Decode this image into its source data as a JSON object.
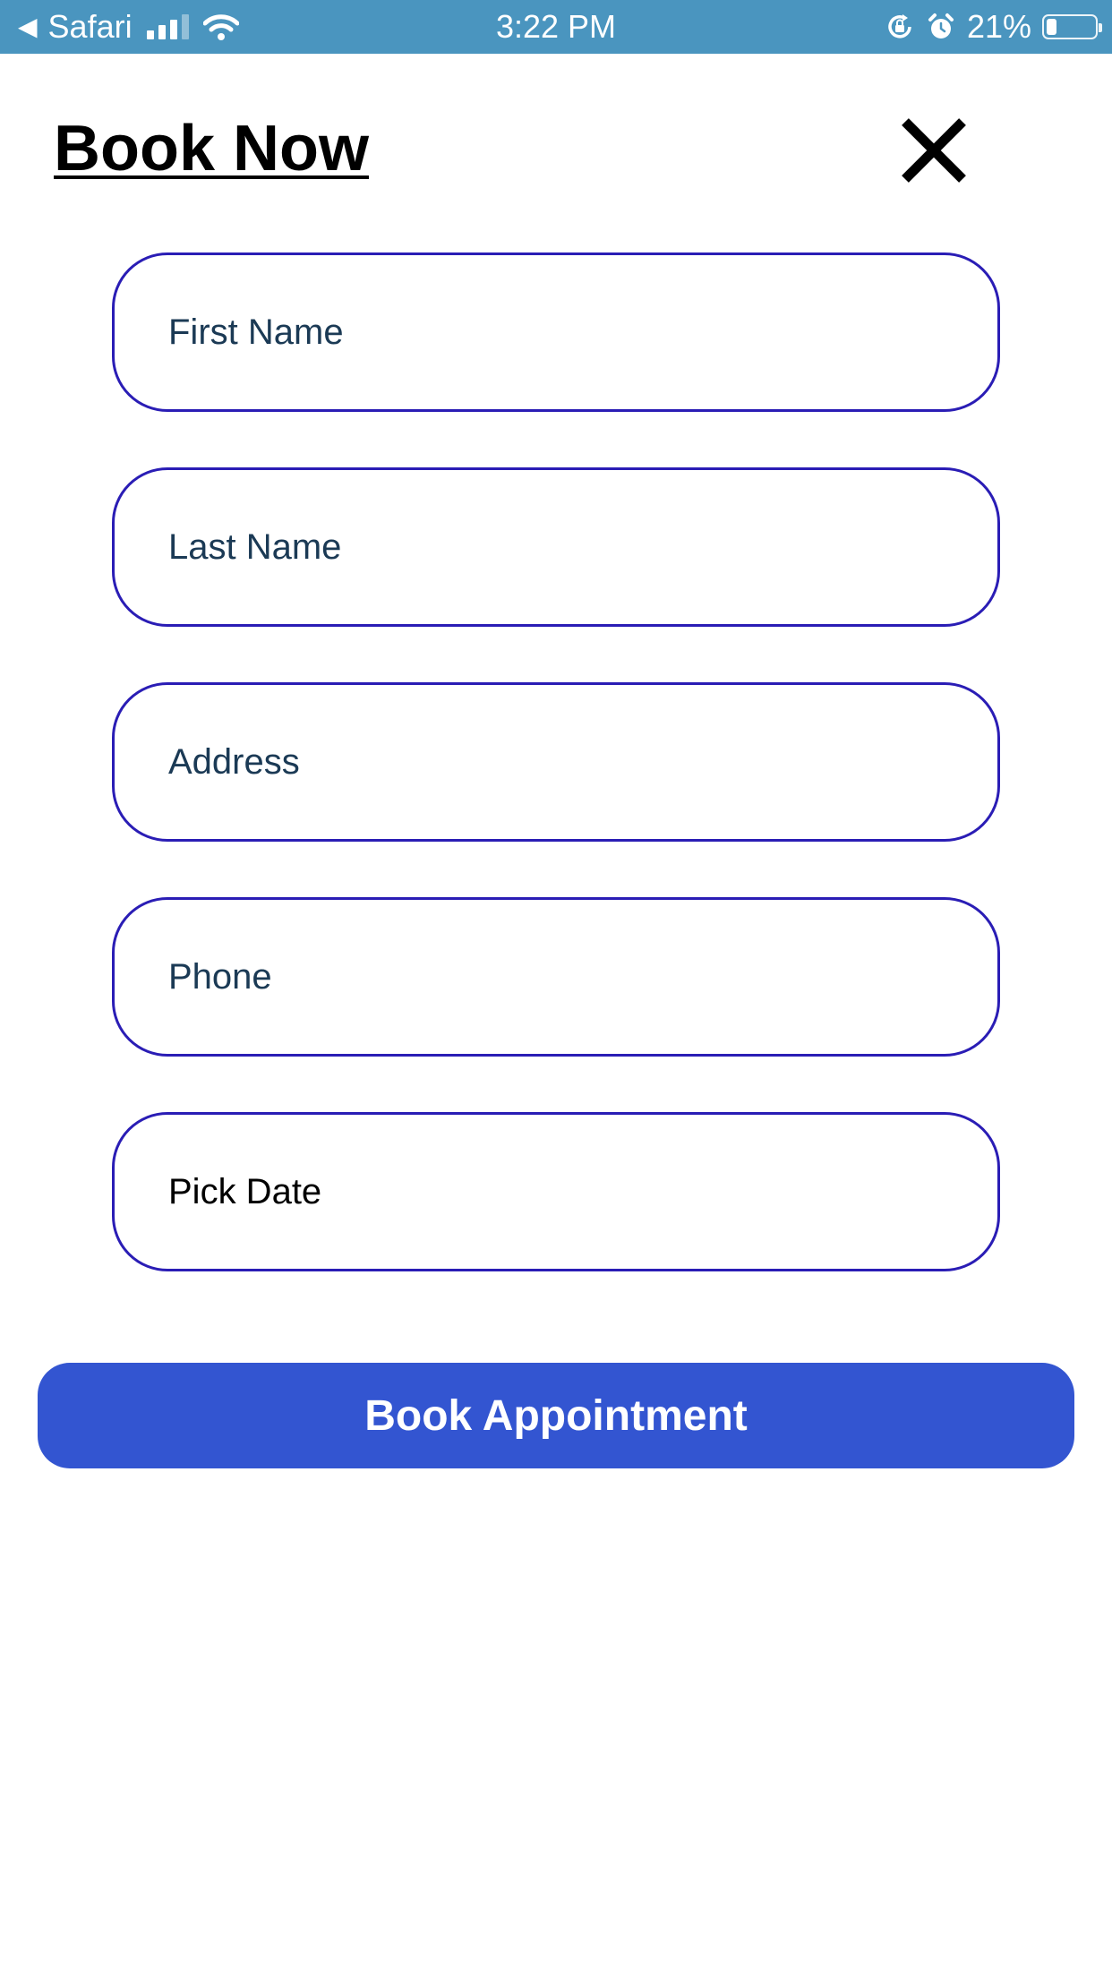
{
  "status_bar": {
    "back_app": "Safari",
    "time": "3:22 PM",
    "battery_percent": "21%",
    "battery_level": 0.21,
    "icons": [
      "back-arrow-icon",
      "cellular-signal-icon",
      "wifi-icon",
      "orientation-lock-icon",
      "alarm-icon",
      "battery-icon"
    ]
  },
  "header": {
    "title": "Book Now",
    "close_icon": "close-icon"
  },
  "form": {
    "first_name": {
      "placeholder": "First Name",
      "value": ""
    },
    "last_name": {
      "placeholder": "Last Name",
      "value": ""
    },
    "address": {
      "placeholder": "Address",
      "value": ""
    },
    "phone": {
      "placeholder": "Phone",
      "value": ""
    },
    "date": {
      "label": "Pick Date"
    },
    "submit_label": "Book Appointment"
  },
  "colors": {
    "status_bar_bg": "#4a95bf",
    "field_border": "#2a1db5",
    "placeholder_text": "#1b3a55",
    "button_bg": "#3355d1",
    "button_text": "#ffffff"
  }
}
